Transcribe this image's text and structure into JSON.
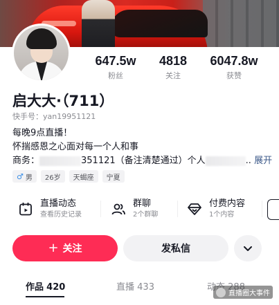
{
  "profile": {
    "nickname": "启大大·（711）",
    "id_line": "快手号：yan19951121",
    "bio_line1": "每晚9点直播！",
    "bio_line2": "怀揣感恩之心面对每一个人和事",
    "bio_line3_prefix": "商务：",
    "bio_line3_mid": "351121（备注清楚通过）个人",
    "bio_line3_suffix": "..",
    "expand_label": "展开"
  },
  "stats": [
    {
      "value": "647.5w",
      "label": "粉丝"
    },
    {
      "value": "4818",
      "label": "关注"
    },
    {
      "value": "6047.8w",
      "label": "获赞"
    }
  ],
  "tags": [
    {
      "icon": "male-icon",
      "glyph": "♂",
      "label": "男"
    },
    {
      "label": "26岁"
    },
    {
      "label": "天蝎座"
    },
    {
      "label": "宁夏"
    }
  ],
  "features": [
    {
      "icon": "live-calendar-icon",
      "title": "直播动态",
      "subtitle": "查看历史记录"
    },
    {
      "icon": "group-chat-icon",
      "title": "群聊",
      "subtitle": "2个群聊"
    },
    {
      "icon": "diamond-icon",
      "title": "付费内容",
      "subtitle": "1个内容"
    }
  ],
  "buttons": {
    "follow": "关注",
    "follow_icon": "+",
    "message": "发私信",
    "more_icon": "chevron-down-icon"
  },
  "tabs": [
    {
      "label": "作品",
      "count": "420",
      "active": true
    },
    {
      "label": "直播",
      "count": "433",
      "active": false
    },
    {
      "label": "动态",
      "count": "288",
      "active": false
    }
  ],
  "watermark": "直播圈大事件",
  "colors": {
    "accent": "#fe2c55",
    "text_primary": "#161823",
    "text_secondary": "#8a8b91",
    "link": "#3d5a8a"
  }
}
